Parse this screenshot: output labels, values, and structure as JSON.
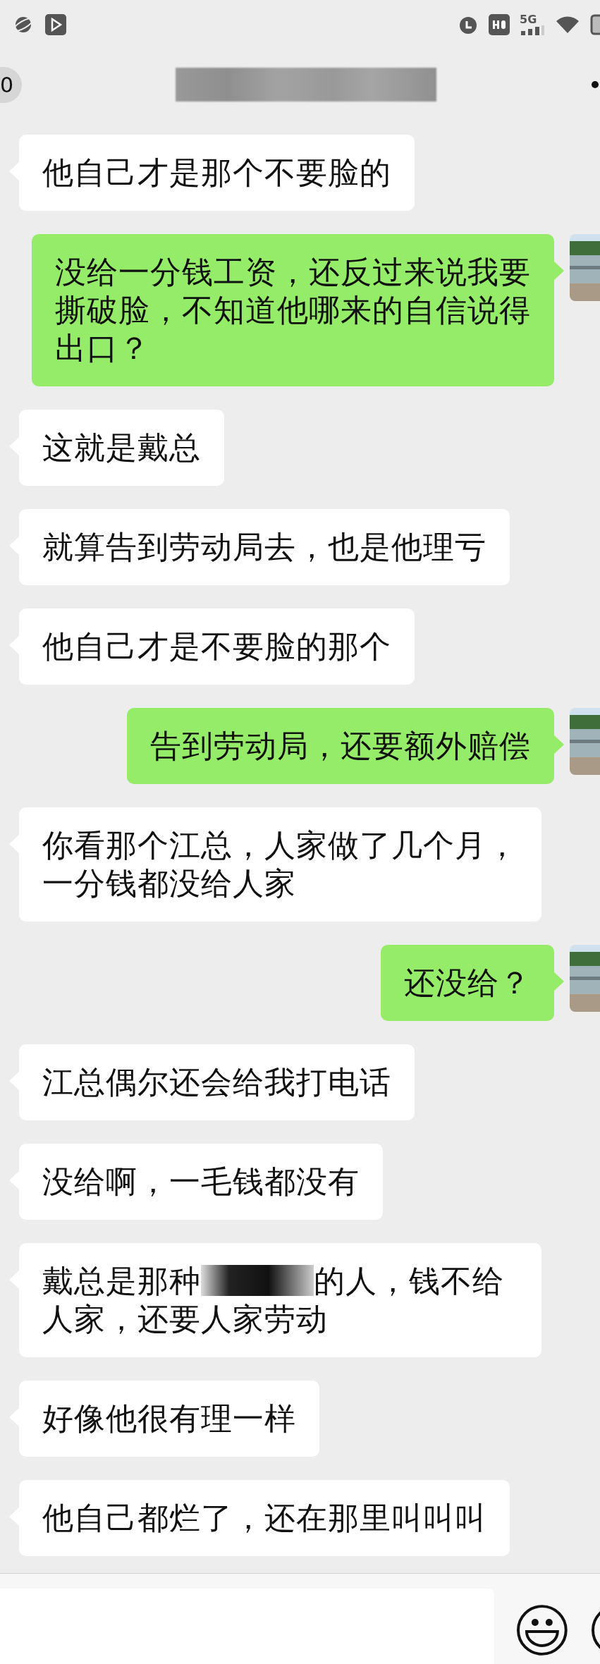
{
  "status_bar": {
    "network": "5G"
  },
  "header": {
    "back_badge": "0",
    "title_redacted": true
  },
  "messages": [
    {
      "kind": "received",
      "text": "他自己才是那个不要脸的"
    },
    {
      "kind": "sent",
      "text": "没给一分钱工资，还反过来说我要撕破脸，不知道他哪来的自信说得出口？"
    },
    {
      "kind": "received",
      "text": "这就是戴总"
    },
    {
      "kind": "received",
      "text": "就算告到劳动局去，也是他理亏"
    },
    {
      "kind": "received",
      "text": "他自己才是不要脸的那个"
    },
    {
      "kind": "sent",
      "text": "告到劳动局，还要额外赔偿"
    },
    {
      "kind": "received",
      "text": "你看那个江总，人家做了几个月，一分钱都没给人家"
    },
    {
      "kind": "sent",
      "text": "还没给？"
    },
    {
      "kind": "received",
      "text": "江总偶尔还会给我打电话"
    },
    {
      "kind": "received",
      "text": "没给啊，一毛钱都没有"
    },
    {
      "kind": "received",
      "parts": [
        {
          "kind": "text",
          "text": "戴总是那种"
        },
        {
          "kind": "redaction"
        },
        {
          "kind": "text",
          "text": "的人，钱不给人家，还要人家劳动"
        }
      ]
    },
    {
      "kind": "received",
      "text": "好像他很有理一样"
    },
    {
      "kind": "received",
      "text": "他自己都烂了，还在那里叫叫叫"
    }
  ]
}
